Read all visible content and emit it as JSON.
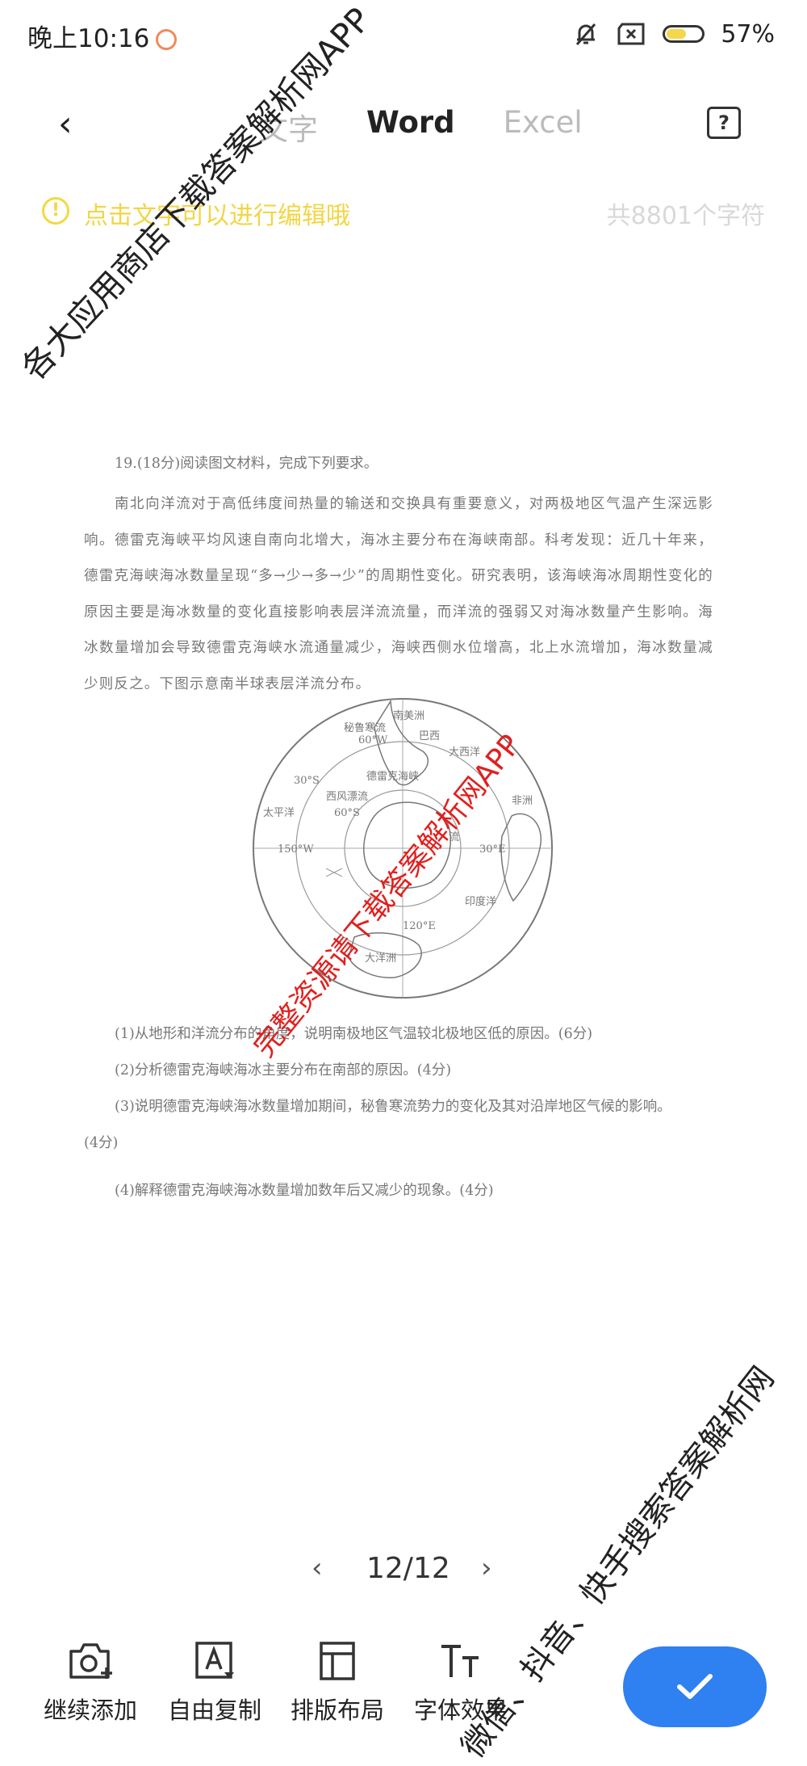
{
  "status": {
    "time": "晚上10:16",
    "battery_pct": "57%",
    "battery_level": 0.57
  },
  "nav": {
    "back": "‹",
    "tabs": [
      {
        "label": "文字"
      },
      {
        "label": "Word"
      },
      {
        "label": "Excel"
      }
    ],
    "active_tab": "Word",
    "help": "?"
  },
  "hint": {
    "text": "点击文字可以进行编辑哦",
    "char_count": "共8801个字符"
  },
  "doc": {
    "question_title": "19.(18分)阅读图文材料，完成下列要求。",
    "paragraph": "南北向洋流对于高低纬度间热量的输送和交换具有重要意义，对两极地区气温产生深远影响。德雷克海峡平均风速自南向北增大，海冰主要分布在海峡南部。科考发现：近几十年来，德雷克海峡海冰数量呈现“多→少→多→少”的周期性变化。研究表明，该海峡海冰周期性变化的原因主要是海冰数量的变化直接影响表层洋流流量，而洋流的强弱又对海冰数量产生影响。海冰数量增加会导致德雷克海峡水流通量减少，海峡西侧水位增高，北上水流增加，海冰数量减少则反之。下图示意南半球表层洋流分布。",
    "map_labels": {
      "south_america": "南美洲",
      "brazil": "巴西",
      "peru": "秘鲁寒流",
      "drake": "德雷克海峡",
      "pacific": "太平洋",
      "atlantic": "大西洋",
      "africa": "非洲",
      "indian": "印度洋",
      "oceania": "大洋洲",
      "west_wind": "西风漂流",
      "flow": "流",
      "lat30": "30°S",
      "lat60": "60°S",
      "lon60w": "60°W",
      "lon150w": "150°W",
      "lon30e": "30°E",
      "lon120e": "120°E"
    },
    "sub_questions": [
      "(1)从地形和洋流分布的角度，说明南极地区气温较北极地区低的原因。(6分)",
      "(2)分析德雷克海峡海冰主要分布在南部的原因。(4分)",
      "(3)说明德雷克海峡海冰数量增加期间，秘鲁寒流势力的变化及其对沿岸地区气候的影响。",
      "(4分)",
      "(4)解释德雷克海峡海冰数量增加数年后又减少的现象。(4分)"
    ]
  },
  "watermarks": {
    "top": "各大应用商店下载答案解析网APP",
    "middle": "完整资源请下载答案解析网APP",
    "bottom": "微信、抖音、快手搜索答案解析网"
  },
  "pager": {
    "prev": "‹",
    "current": "12/12",
    "next": "›"
  },
  "toolbar": {
    "items": [
      {
        "label": "继续添加",
        "icon": "camera-add-icon"
      },
      {
        "label": "自由复制",
        "icon": "text-select-icon"
      },
      {
        "label": "排版布局",
        "icon": "layout-icon"
      },
      {
        "label": "字体效果",
        "icon": "font-icon"
      }
    ],
    "confirm_icon": "check-icon"
  },
  "colors": {
    "accent": "#2f80f0",
    "hint": "#f2d545",
    "watermark_red": "#e0201e"
  }
}
